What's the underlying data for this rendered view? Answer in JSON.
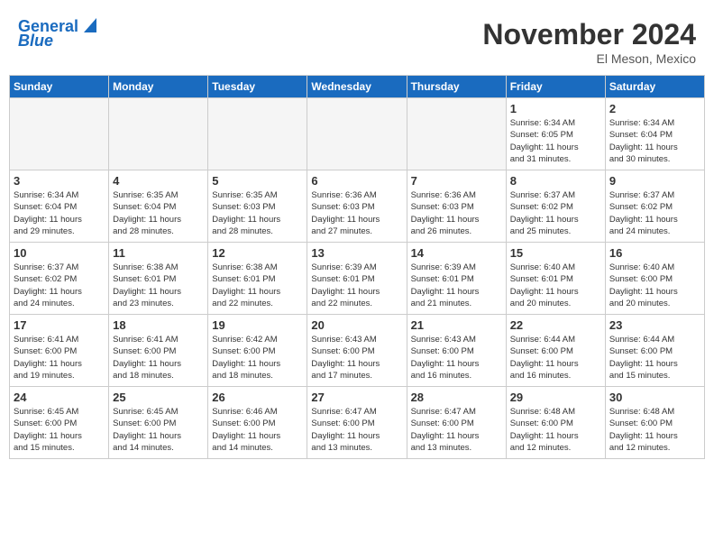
{
  "header": {
    "logo_line1": "General",
    "logo_line2": "Blue",
    "month": "November 2024",
    "location": "El Meson, Mexico"
  },
  "weekdays": [
    "Sunday",
    "Monday",
    "Tuesday",
    "Wednesday",
    "Thursday",
    "Friday",
    "Saturday"
  ],
  "weeks": [
    [
      {
        "day": "",
        "info": ""
      },
      {
        "day": "",
        "info": ""
      },
      {
        "day": "",
        "info": ""
      },
      {
        "day": "",
        "info": ""
      },
      {
        "day": "",
        "info": ""
      },
      {
        "day": "1",
        "info": "Sunrise: 6:34 AM\nSunset: 6:05 PM\nDaylight: 11 hours\nand 31 minutes."
      },
      {
        "day": "2",
        "info": "Sunrise: 6:34 AM\nSunset: 6:04 PM\nDaylight: 11 hours\nand 30 minutes."
      }
    ],
    [
      {
        "day": "3",
        "info": "Sunrise: 6:34 AM\nSunset: 6:04 PM\nDaylight: 11 hours\nand 29 minutes."
      },
      {
        "day": "4",
        "info": "Sunrise: 6:35 AM\nSunset: 6:04 PM\nDaylight: 11 hours\nand 28 minutes."
      },
      {
        "day": "5",
        "info": "Sunrise: 6:35 AM\nSunset: 6:03 PM\nDaylight: 11 hours\nand 28 minutes."
      },
      {
        "day": "6",
        "info": "Sunrise: 6:36 AM\nSunset: 6:03 PM\nDaylight: 11 hours\nand 27 minutes."
      },
      {
        "day": "7",
        "info": "Sunrise: 6:36 AM\nSunset: 6:03 PM\nDaylight: 11 hours\nand 26 minutes."
      },
      {
        "day": "8",
        "info": "Sunrise: 6:37 AM\nSunset: 6:02 PM\nDaylight: 11 hours\nand 25 minutes."
      },
      {
        "day": "9",
        "info": "Sunrise: 6:37 AM\nSunset: 6:02 PM\nDaylight: 11 hours\nand 24 minutes."
      }
    ],
    [
      {
        "day": "10",
        "info": "Sunrise: 6:37 AM\nSunset: 6:02 PM\nDaylight: 11 hours\nand 24 minutes."
      },
      {
        "day": "11",
        "info": "Sunrise: 6:38 AM\nSunset: 6:01 PM\nDaylight: 11 hours\nand 23 minutes."
      },
      {
        "day": "12",
        "info": "Sunrise: 6:38 AM\nSunset: 6:01 PM\nDaylight: 11 hours\nand 22 minutes."
      },
      {
        "day": "13",
        "info": "Sunrise: 6:39 AM\nSunset: 6:01 PM\nDaylight: 11 hours\nand 22 minutes."
      },
      {
        "day": "14",
        "info": "Sunrise: 6:39 AM\nSunset: 6:01 PM\nDaylight: 11 hours\nand 21 minutes."
      },
      {
        "day": "15",
        "info": "Sunrise: 6:40 AM\nSunset: 6:01 PM\nDaylight: 11 hours\nand 20 minutes."
      },
      {
        "day": "16",
        "info": "Sunrise: 6:40 AM\nSunset: 6:00 PM\nDaylight: 11 hours\nand 20 minutes."
      }
    ],
    [
      {
        "day": "17",
        "info": "Sunrise: 6:41 AM\nSunset: 6:00 PM\nDaylight: 11 hours\nand 19 minutes."
      },
      {
        "day": "18",
        "info": "Sunrise: 6:41 AM\nSunset: 6:00 PM\nDaylight: 11 hours\nand 18 minutes."
      },
      {
        "day": "19",
        "info": "Sunrise: 6:42 AM\nSunset: 6:00 PM\nDaylight: 11 hours\nand 18 minutes."
      },
      {
        "day": "20",
        "info": "Sunrise: 6:43 AM\nSunset: 6:00 PM\nDaylight: 11 hours\nand 17 minutes."
      },
      {
        "day": "21",
        "info": "Sunrise: 6:43 AM\nSunset: 6:00 PM\nDaylight: 11 hours\nand 16 minutes."
      },
      {
        "day": "22",
        "info": "Sunrise: 6:44 AM\nSunset: 6:00 PM\nDaylight: 11 hours\nand 16 minutes."
      },
      {
        "day": "23",
        "info": "Sunrise: 6:44 AM\nSunset: 6:00 PM\nDaylight: 11 hours\nand 15 minutes."
      }
    ],
    [
      {
        "day": "24",
        "info": "Sunrise: 6:45 AM\nSunset: 6:00 PM\nDaylight: 11 hours\nand 15 minutes."
      },
      {
        "day": "25",
        "info": "Sunrise: 6:45 AM\nSunset: 6:00 PM\nDaylight: 11 hours\nand 14 minutes."
      },
      {
        "day": "26",
        "info": "Sunrise: 6:46 AM\nSunset: 6:00 PM\nDaylight: 11 hours\nand 14 minutes."
      },
      {
        "day": "27",
        "info": "Sunrise: 6:47 AM\nSunset: 6:00 PM\nDaylight: 11 hours\nand 13 minutes."
      },
      {
        "day": "28",
        "info": "Sunrise: 6:47 AM\nSunset: 6:00 PM\nDaylight: 11 hours\nand 13 minutes."
      },
      {
        "day": "29",
        "info": "Sunrise: 6:48 AM\nSunset: 6:00 PM\nDaylight: 11 hours\nand 12 minutes."
      },
      {
        "day": "30",
        "info": "Sunrise: 6:48 AM\nSunset: 6:00 PM\nDaylight: 11 hours\nand 12 minutes."
      }
    ]
  ]
}
